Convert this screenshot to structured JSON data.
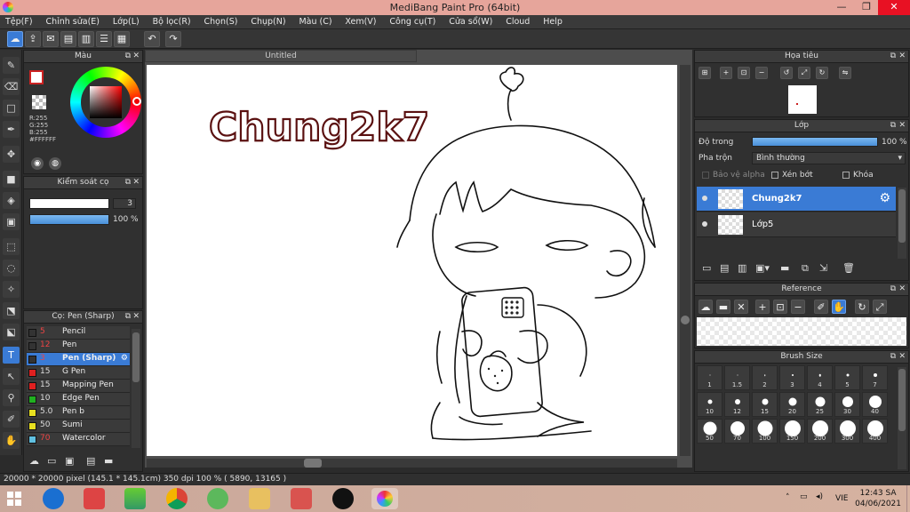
{
  "window": {
    "title": "MediBang Paint Pro (64bit)",
    "min": "—",
    "max": "❐",
    "close": "✕"
  },
  "menu": [
    "Tệp(F)",
    "Chỉnh sửa(E)",
    "Lớp(L)",
    "Bộ lọc(R)",
    "Chọn(S)",
    "Chụp(N)",
    "Màu (C)",
    "Xem(V)",
    "Công cụ(T)",
    "Cửa sổ(W)",
    "Cloud",
    "Help"
  ],
  "color_panel": {
    "title": "Màu",
    "r": "R:255",
    "g": "G:255",
    "b": "B:255",
    "hex": "#FFFFFF",
    "fg_color": "#cc2222"
  },
  "brush_control": {
    "title": "Kiểm soát cọ",
    "size": "3",
    "opacity": "100 %"
  },
  "brush_list": {
    "title": "Cọ: Pen (Sharp)",
    "items": [
      {
        "size": "5",
        "name": "Pencil",
        "color": "#333333"
      },
      {
        "size": "12",
        "name": "Pen",
        "color": "#333333"
      },
      {
        "size": "3",
        "name": "Pen (Sharp)",
        "color": "#333333"
      },
      {
        "size": "15",
        "name": "G Pen",
        "color": "#e02020"
      },
      {
        "size": "15",
        "name": "Mapping Pen",
        "color": "#e02020"
      },
      {
        "size": "10",
        "name": "Edge Pen",
        "color": "#20b020"
      },
      {
        "size": "5.0",
        "name": "Pen b",
        "color": "#e8e020"
      },
      {
        "size": "50",
        "name": "Sumi",
        "color": "#e8e020"
      },
      {
        "size": "70",
        "name": "Watercolor",
        "color": "#60c0e0"
      }
    ]
  },
  "canvas": {
    "tab": "Untitled",
    "text_layer": "Chung2k7"
  },
  "navigator": {
    "title": "Họa tiêu"
  },
  "layers": {
    "title": "Lớp",
    "opacity_label": "Độ trong",
    "opacity_value": "100 %",
    "blend_label": "Pha trộn",
    "blend_value": "Bình thường",
    "protect_alpha": "Bảo vệ alpha",
    "clipping": "Xén bớt",
    "lock": "Khóa",
    "items": [
      {
        "name": "Chung2k7",
        "active": true
      },
      {
        "name": "Lớp5",
        "active": false
      }
    ]
  },
  "reference": {
    "title": "Reference"
  },
  "brush_size": {
    "title": "Brush Size",
    "sizes": [
      "1",
      "1.5",
      "2",
      "3",
      "4",
      "5",
      "7",
      "10",
      "12",
      "15",
      "20",
      "25",
      "30",
      "40",
      "50",
      "70",
      "100",
      "150",
      "200",
      "300",
      "400"
    ]
  },
  "status": {
    "text": "20000 * 20000 pixel   (145.1 * 145.1cm)   350 dpi   100 %   ( 5890, 13165 )"
  },
  "taskbar": {
    "lang": "VIE",
    "time": "12:43 SA",
    "date": "04/06/2021"
  }
}
